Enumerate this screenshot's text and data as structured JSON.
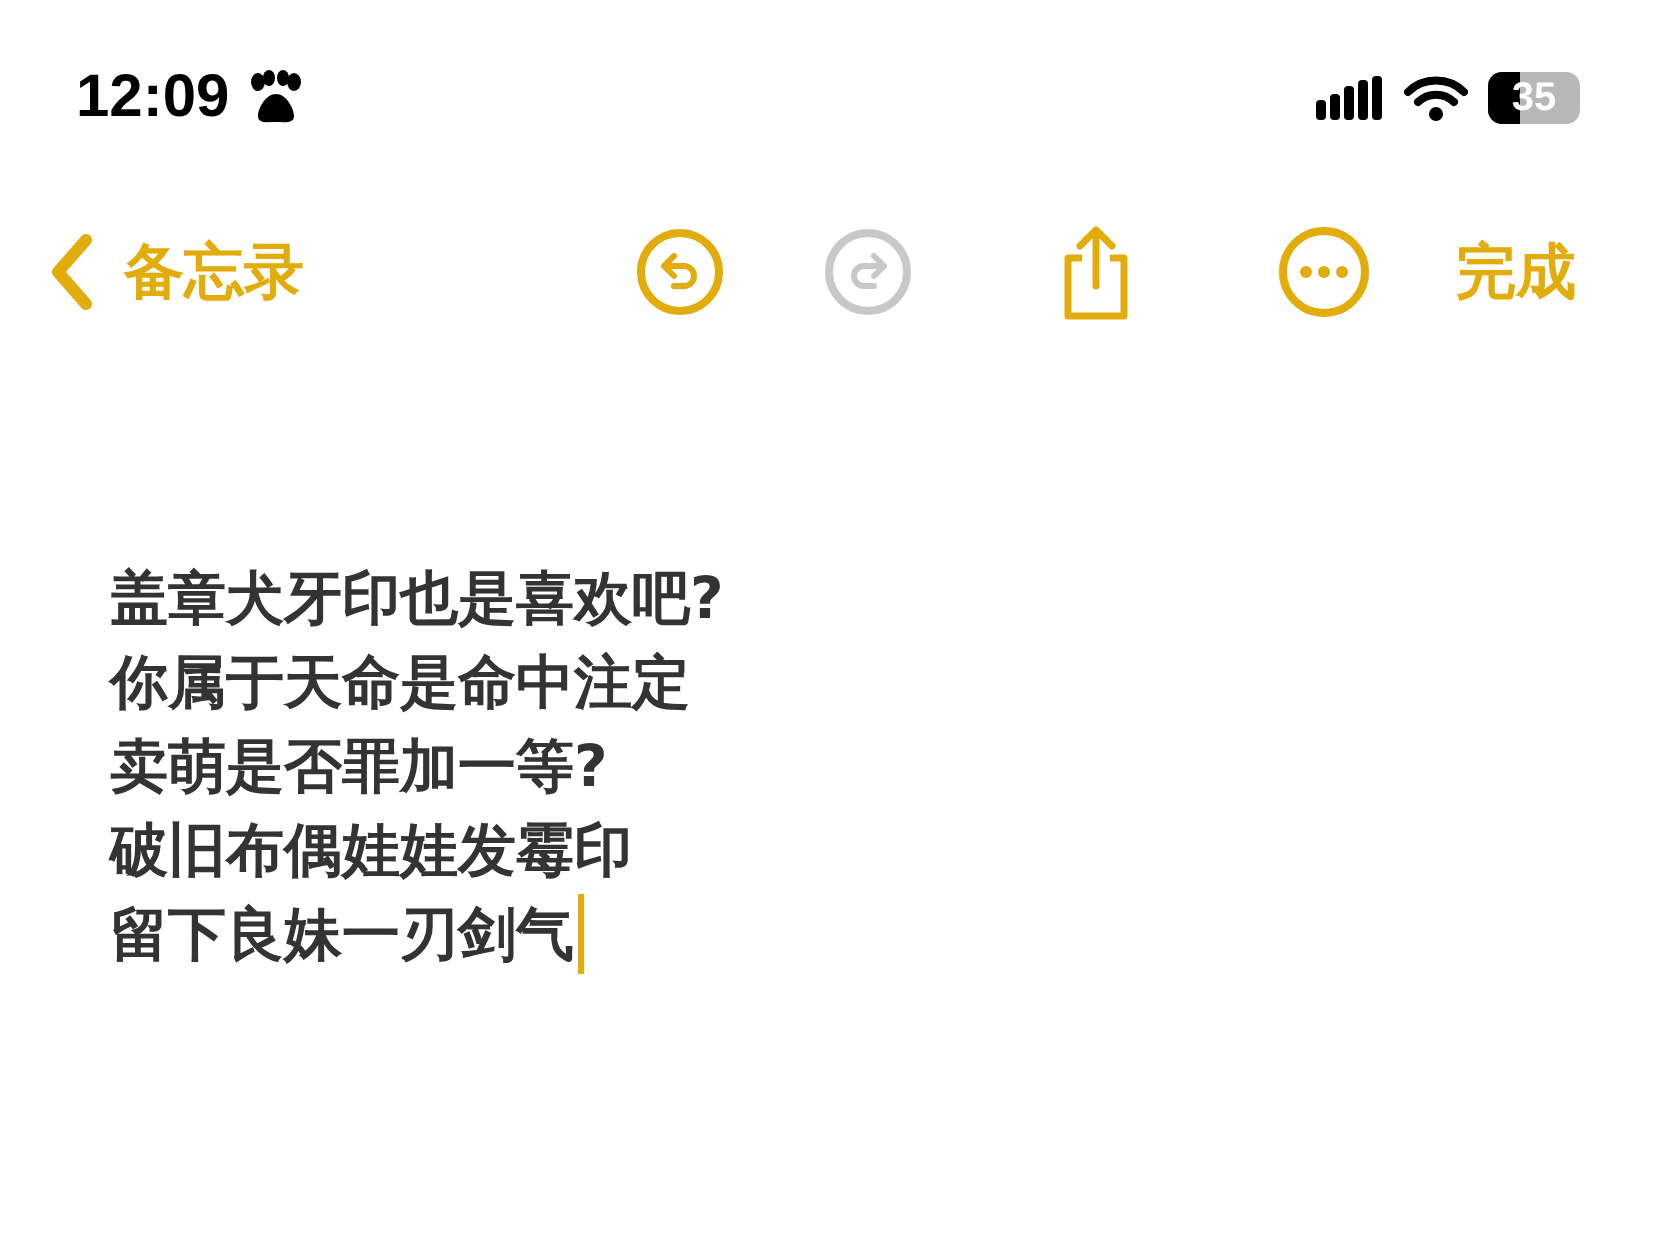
{
  "status_bar": {
    "time": "12:09",
    "battery": "35"
  },
  "nav": {
    "back": "备忘录",
    "undo": {
      "disabled": false
    },
    "redo": {
      "disabled": true
    },
    "done": "完成"
  },
  "note": {
    "lines": [
      "盖章犬牙印也是喜欢吧?",
      "你属于天命是命中注定",
      "卖萌是否罪加一等?",
      "破旧布偶娃娃发霉印",
      "留下良妹一刃剑气"
    ],
    "cursor": true
  }
}
